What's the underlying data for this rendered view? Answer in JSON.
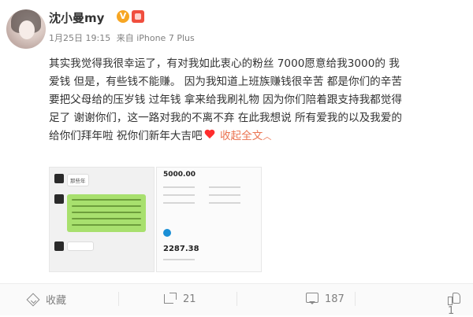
{
  "user": {
    "nickname": "沈小曼my",
    "verified_badge": "V",
    "avatar_icon": "avatar"
  },
  "meta": {
    "time": "1月25日 19:15",
    "source": "来自 iPhone 7 Plus"
  },
  "post": {
    "lines": [
      "其实我觉得我很幸运了，有对我如此衷心的粉丝 7000愿意给我3000的 我",
      "爱钱 但是，有些钱不能赚。 因为我知道上班族赚钱很辛苦 都是你们的辛苦",
      "要把父母给的压岁钱 过年钱 拿来给我刷礼物 因为你们陪着跟支持我都觉得",
      "足了 谢谢你们，这一路对我的不离不弃 在此我想说 所有爱我的以及我爱的",
      "给你们拜年啦 祝你们新年大吉吧"
    ],
    "collapse_label": "收起全文",
    "collapse_arrow": "︿"
  },
  "images": {
    "chat_name": "那些年",
    "transfer_title": "5000.00",
    "transfer_amount": "2287.38"
  },
  "actions": {
    "favorite_label": "收藏",
    "share_count": "21",
    "comment_count": "187",
    "like_count": "1"
  },
  "colors": {
    "link": "#eb7350",
    "badge": "#f7a623"
  }
}
